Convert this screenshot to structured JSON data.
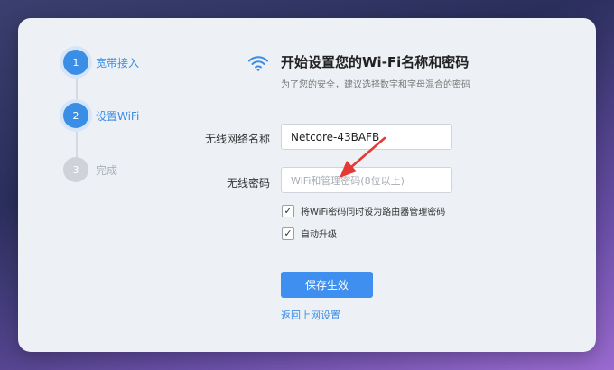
{
  "steps": [
    {
      "number": "1",
      "label": "宽带接入",
      "state": "active"
    },
    {
      "number": "2",
      "label": "设置WiFi",
      "state": "active"
    },
    {
      "number": "3",
      "label": "完成",
      "state": "pending"
    }
  ],
  "header": {
    "icon": "wifi-icon",
    "title": "开始设置您的Wi-Fi名称和密码",
    "subtitle": "为了您的安全，建议选择数字和字母混合的密码"
  },
  "form": {
    "ssid_label": "无线网络名称",
    "ssid_value": "Netcore-43BAFB",
    "password_label": "无线密码",
    "password_placeholder": "WiFi和管理密码(8位以上)",
    "option_sync_label": "将WiFi密码同时设为路由器管理密码",
    "option_sync_checked": true,
    "option_auto_label": "自动升级",
    "option_auto_checked": true,
    "save_label": "保存生效",
    "back_label": "返回上网设置"
  },
  "colors": {
    "accent": "#3a8ee6",
    "annotation_arrow": "#e53935"
  }
}
